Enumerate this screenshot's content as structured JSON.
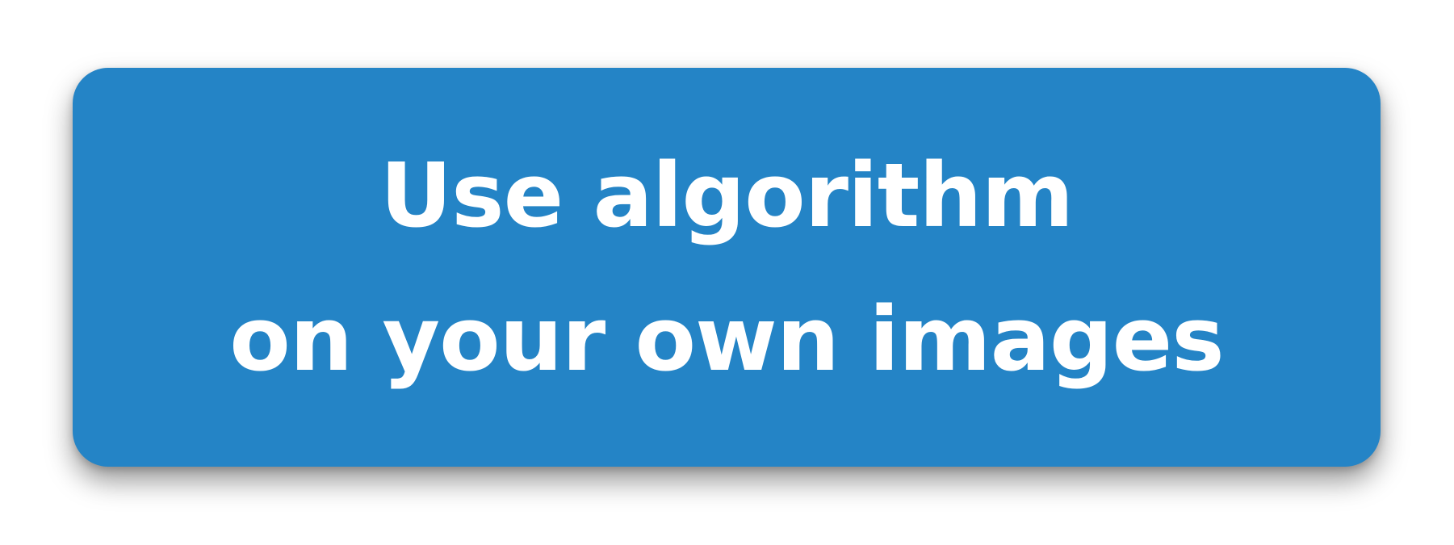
{
  "button": {
    "line1": "Use algorithm",
    "line2": "on your own images",
    "background_color": "#2484C6",
    "text_color": "#FFFFFF"
  }
}
